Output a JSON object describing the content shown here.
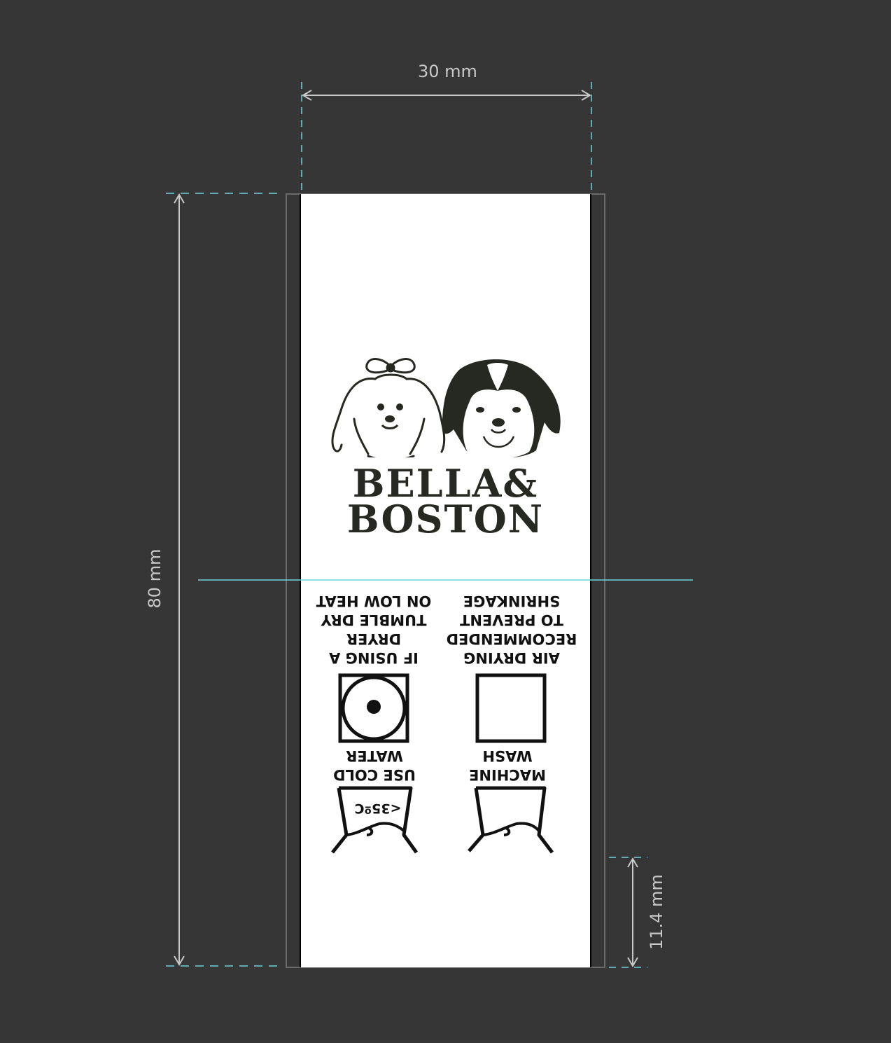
{
  "dimensions": {
    "width_label": "30 mm",
    "height_label": "80 mm",
    "bottom_label": "11.4 mm"
  },
  "brand": {
    "line1": "BELLA&",
    "line2": "BOSTON",
    "logo_icon": "two-dogs-logo"
  },
  "care": {
    "tumble_dry": "IF USING A\nDRYER\nTUMBLE DRY\nON LOW HEAT",
    "air_dry": "AIR DRYING\nRECOMMENDED\nTO PREVENT\nSHRINKAGE",
    "cold_water": "USE COLD\nWATER",
    "machine_wash": "MACHINE\nWASH",
    "temperature": "<35ºC"
  },
  "colors": {
    "background": "#363636",
    "label": "#ffffff",
    "guide": "#6fd3dc",
    "ink": "#111111"
  }
}
